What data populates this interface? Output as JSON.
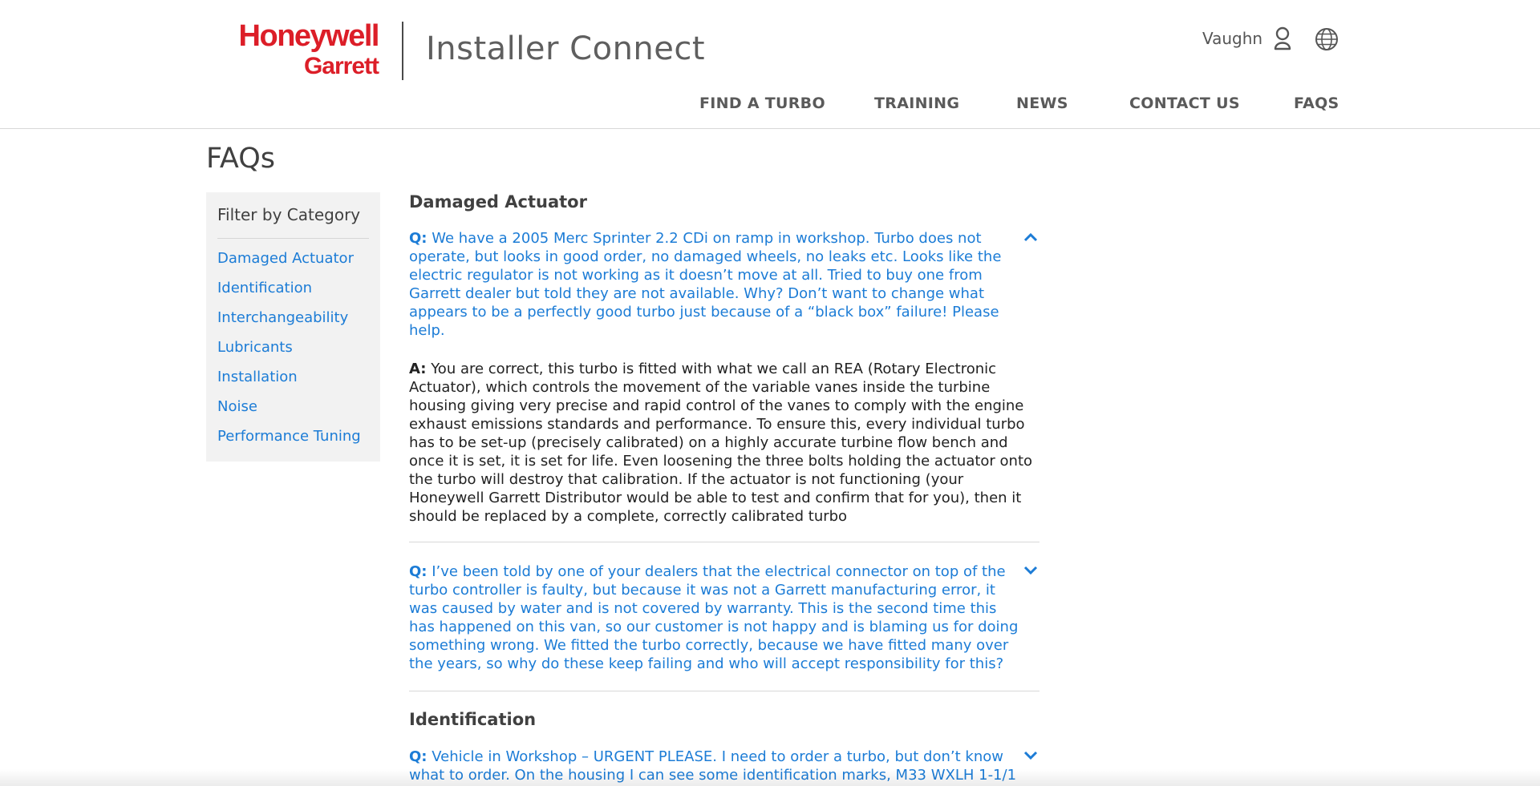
{
  "brand": {
    "logo_line1": "Honeywell",
    "logo_line2": "Garrett",
    "app_title": "Installer Connect",
    "brand_color": "#dc1e28",
    "link_color": "#1c7cd6"
  },
  "user": {
    "name": "Vaughn",
    "user_icon": "user-icon",
    "language_icon": "globe-icon"
  },
  "nav": {
    "items": [
      {
        "label": "FIND A TURBO"
      },
      {
        "label": "TRAINING"
      },
      {
        "label": "NEWS"
      },
      {
        "label": "CONTACT US"
      },
      {
        "label": "FAQS"
      }
    ]
  },
  "page": {
    "title": "FAQs"
  },
  "sidebar": {
    "heading": "Filter by Category",
    "items": [
      {
        "label": "Damaged Actuator"
      },
      {
        "label": "Identification"
      },
      {
        "label": "Interchangeability"
      },
      {
        "label": "Lubricants"
      },
      {
        "label": "Installation"
      },
      {
        "label": "Noise"
      },
      {
        "label": "Performance Tuning"
      }
    ]
  },
  "sections": [
    {
      "title": "Damaged Actuator",
      "faqs": [
        {
          "q_prefix": "Q:",
          "question": "We have a 2005 Merc Sprinter 2.2 CDi on ramp in workshop. Turbo does not operate, but looks in good order, no damaged wheels, no leaks etc. Looks like the electric regulator is not working as it doesn’t move at all. Tried to buy one from Garrett dealer but told they are not available. Why? Don’t want to change what appears to be a perfectly good turbo just because of a “black box” failure! Please help.",
          "expanded": true,
          "a_prefix": "A:",
          "answer": "You are correct, this turbo is fitted with what we call an REA (Rotary Electronic Actuator), which controls the movement of the variable vanes inside the turbine housing giving very precise and rapid control of the vanes to comply with the engine exhaust emissions standards and performance. To ensure this, every individual turbo has to be set-up (precisely calibrated) on a highly accurate turbine flow bench and once it is set, it is set for life. Even loosening the three bolts holding the actuator onto the turbo will destroy that calibration. If the actuator is not functioning (your Honeywell Garrett Distributor would be able to test and confirm that for you), then it should be replaced by a complete, correctly calibrated turbo"
        },
        {
          "q_prefix": "Q:",
          "question": "I’ve been told by one of your dealers that the electrical connector on top of the turbo controller is faulty, but because it was not a Garrett manufacturing error, it was caused by water and is not covered by warranty. This is the second time this has happened on this van, so our customer is not happy and is blaming us for doing something wrong. We fitted the turbo correctly, because we have fitted many over the years, so why do these keep failing and who will accept responsibility for this?",
          "expanded": false
        }
      ]
    },
    {
      "title": "Identification",
      "faqs": [
        {
          "q_prefix": "Q:",
          "question": "Vehicle in Workshop – URGENT PLEASE. I need to order a turbo, but don’t know what to order. On the housing I can see some identification marks, M33 WXLH 1-1/1",
          "expanded": false
        }
      ]
    }
  ]
}
